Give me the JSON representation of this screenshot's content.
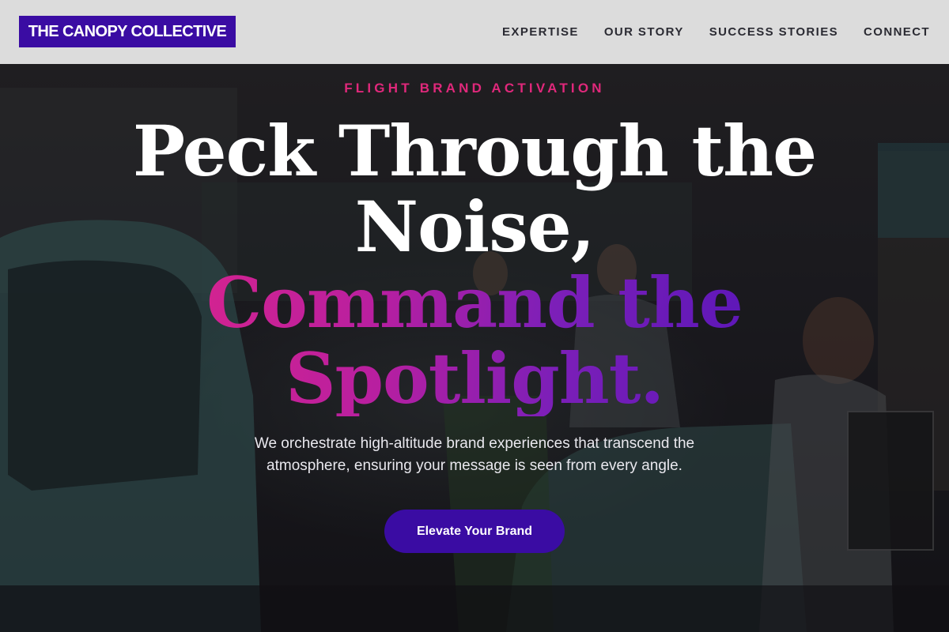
{
  "header": {
    "logo_text": "THE CANOPY COLLECTIVE",
    "nav": [
      {
        "label": "EXPERTISE"
      },
      {
        "label": "OUR STORY"
      },
      {
        "label": "SUCCESS STORIES"
      },
      {
        "label": "CONNECT"
      }
    ]
  },
  "hero": {
    "eyebrow": "FLIGHT BRAND ACTIVATION",
    "headline": {
      "line1": "Peck Through the",
      "line2": "Noise,",
      "line3": "Command the",
      "line4": "Spotlight."
    },
    "subtitle": "We orchestrate high-altitude brand experiences that transcend the atmosphere, ensuring your message is seen from every angle.",
    "cta_label": "Elevate Your Brand"
  },
  "colors": {
    "brand_purple": "#3a0ca3",
    "accent_pink": "#e0287b",
    "header_bg": "#dcdcdc",
    "nav_text": "#2b2b33"
  }
}
